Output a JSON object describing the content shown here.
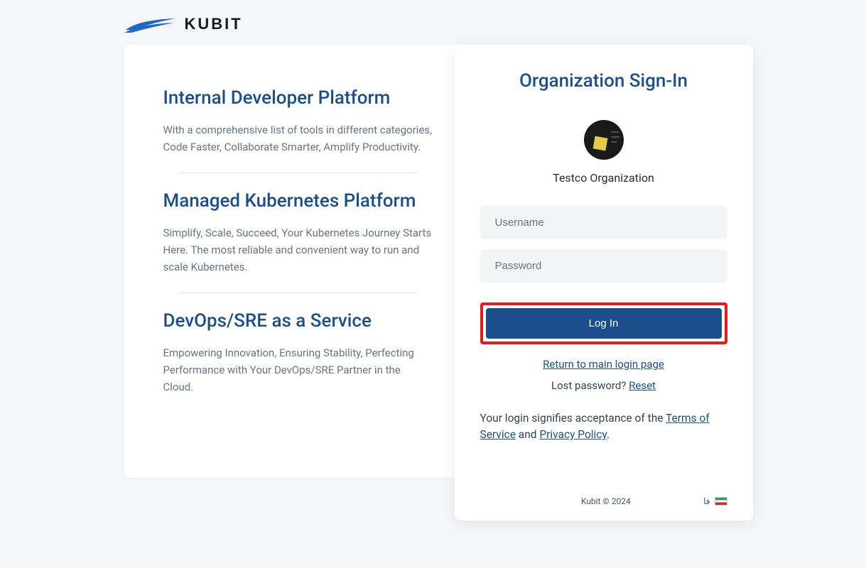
{
  "brand": {
    "name": "KUBIT"
  },
  "features": [
    {
      "title": "Internal Developer Platform",
      "desc": "With a comprehensive list of tools in different categories, Code Faster, Collaborate Smarter, Amplify Productivity."
    },
    {
      "title": "Managed Kubernetes Platform",
      "desc": "Simplify, Scale, Succeed, Your Kubernetes Journey Starts Here. The most reliable and convenient way to run and scale Kubernetes."
    },
    {
      "title": "DevOps/SRE as a Service",
      "desc": "Empowering Innovation, Ensuring Stability, Perfecting Performance with Your DevOps/SRE Partner in the Cloud."
    }
  ],
  "login": {
    "title": "Organization Sign-In",
    "org_name": "Testco Organization",
    "username_placeholder": "Username",
    "password_placeholder": "Password",
    "login_btn": "Log In",
    "return_link": "Return to main login page",
    "lost_pw_text": "Lost password? ",
    "reset_link": "Reset",
    "legal_prefix": "Your login signifies acceptance of the ",
    "tos": "Terms of Service",
    "legal_and": " and ",
    "privacy": "Privacy Policy",
    "legal_suffix": "."
  },
  "footer": {
    "copyright": "Kubit © 2024",
    "lang": "فا"
  }
}
